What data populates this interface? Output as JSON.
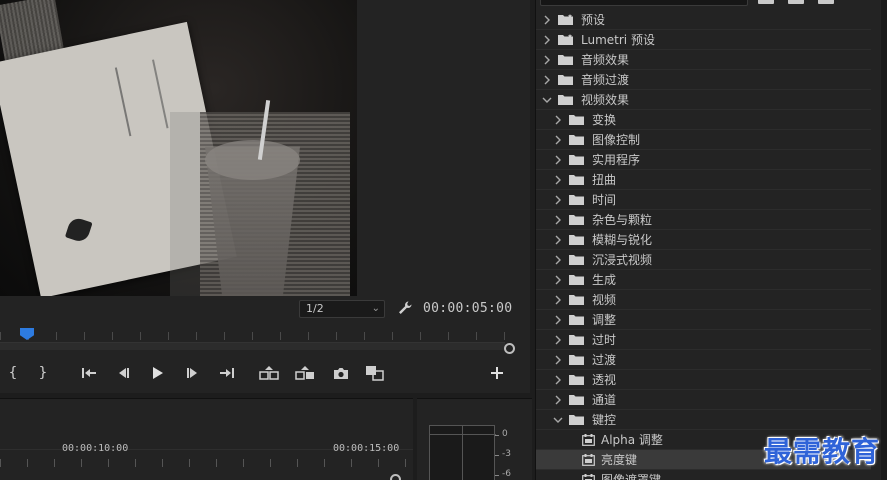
{
  "monitor": {
    "zoom_level": "1/2",
    "duration_timecode": "00:00:05:00"
  },
  "transport": {
    "buttons": [
      {
        "name": "mark-in-button",
        "glyph": "{"
      },
      {
        "name": "mark-out-button",
        "glyph": "}"
      }
    ]
  },
  "timeline": {
    "time_a": "00:00:10:00",
    "time_b": "00:00:15:00"
  },
  "meter": {
    "db_labels": [
      "0",
      "-3",
      "-6"
    ]
  },
  "effects": {
    "items": [
      {
        "label": "预设",
        "depth": 0,
        "expanded": false,
        "kind": "preset-folder"
      },
      {
        "label": "Lumetri 预设",
        "depth": 0,
        "expanded": false,
        "kind": "preset-folder"
      },
      {
        "label": "音频效果",
        "depth": 0,
        "expanded": false,
        "kind": "folder"
      },
      {
        "label": "音频过渡",
        "depth": 0,
        "expanded": false,
        "kind": "folder"
      },
      {
        "label": "视频效果",
        "depth": 0,
        "expanded": true,
        "kind": "folder"
      },
      {
        "label": "变换",
        "depth": 1,
        "expanded": false,
        "kind": "folder"
      },
      {
        "label": "图像控制",
        "depth": 1,
        "expanded": false,
        "kind": "folder"
      },
      {
        "label": "实用程序",
        "depth": 1,
        "expanded": false,
        "kind": "folder"
      },
      {
        "label": "扭曲",
        "depth": 1,
        "expanded": false,
        "kind": "folder"
      },
      {
        "label": "时间",
        "depth": 1,
        "expanded": false,
        "kind": "folder"
      },
      {
        "label": "杂色与颗粒",
        "depth": 1,
        "expanded": false,
        "kind": "folder"
      },
      {
        "label": "模糊与锐化",
        "depth": 1,
        "expanded": false,
        "kind": "folder"
      },
      {
        "label": "沉浸式视频",
        "depth": 1,
        "expanded": false,
        "kind": "folder"
      },
      {
        "label": "生成",
        "depth": 1,
        "expanded": false,
        "kind": "folder"
      },
      {
        "label": "视频",
        "depth": 1,
        "expanded": false,
        "kind": "folder"
      },
      {
        "label": "调整",
        "depth": 1,
        "expanded": false,
        "kind": "folder"
      },
      {
        "label": "过时",
        "depth": 1,
        "expanded": false,
        "kind": "folder"
      },
      {
        "label": "过渡",
        "depth": 1,
        "expanded": false,
        "kind": "folder"
      },
      {
        "label": "透视",
        "depth": 1,
        "expanded": false,
        "kind": "folder"
      },
      {
        "label": "通道",
        "depth": 1,
        "expanded": false,
        "kind": "folder"
      },
      {
        "label": "键控",
        "depth": 1,
        "expanded": true,
        "kind": "folder"
      },
      {
        "label": "Alpha 调整",
        "depth": 2,
        "kind": "effect"
      },
      {
        "label": "亮度键",
        "depth": 2,
        "kind": "effect",
        "selected": true
      },
      {
        "label": "图像遮罩键",
        "depth": 2,
        "kind": "effect"
      }
    ]
  },
  "watermark": "最需教育",
  "colors": {
    "accent": "#2d7be0",
    "panel": "#232323",
    "text": "#c8c8c8",
    "watermark": "#2f63d8"
  }
}
